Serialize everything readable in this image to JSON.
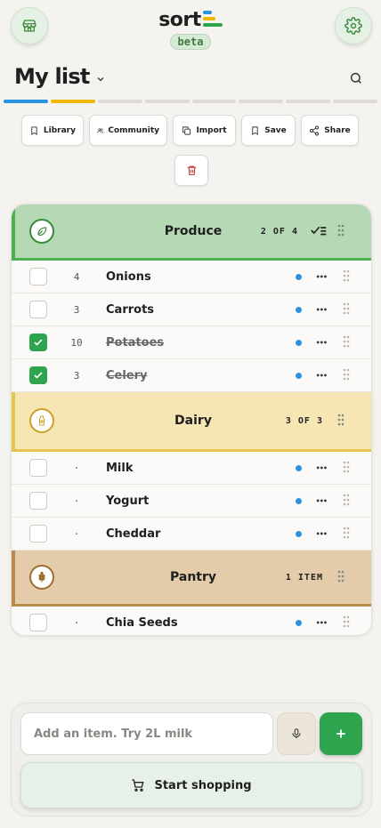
{
  "header": {
    "logo_text": "sort",
    "logo_bar_colors": [
      "#2a93e0",
      "#f2b705",
      "#2ea44f"
    ],
    "badge": "beta",
    "list_title": "My list"
  },
  "progress_segment_colors": [
    "#2a93e0",
    "#f2b705",
    "#dedbd5",
    "#dedbd5",
    "#dedbd5",
    "#dedbd5",
    "#dedbd5",
    "#dedbd5"
  ],
  "toolbar": {
    "library": "Library",
    "community": "Community",
    "import": "Import",
    "save": "Save",
    "share": "Share"
  },
  "categories": [
    {
      "name": "Produce",
      "count": "2 OF 4",
      "icon": "leaf-icon",
      "colors": {
        "bg": "#b4d9b4",
        "accent": "#4caf50",
        "icon": "#3b8a3b"
      },
      "items": [
        {
          "qty": "4",
          "name": "Onions",
          "checked": false
        },
        {
          "qty": "3",
          "name": "Carrots",
          "checked": false
        },
        {
          "qty": "10",
          "name": "Potatoes",
          "checked": true
        },
        {
          "qty": "3",
          "name": "Celery",
          "checked": true
        }
      ]
    },
    {
      "name": "Dairy",
      "count": "3 OF 3",
      "icon": "milk-bottle-icon",
      "colors": {
        "bg": "#f6e6b4",
        "accent": "#e7c54b",
        "icon": "#c9a227"
      },
      "items": [
        {
          "qty": "·",
          "name": "Milk",
          "checked": false
        },
        {
          "qty": "·",
          "name": "Yogurt",
          "checked": false
        },
        {
          "qty": "·",
          "name": "Cheddar",
          "checked": false
        }
      ]
    },
    {
      "name": "Pantry",
      "count": "1 ITEM",
      "icon": "wheat-icon",
      "colors": {
        "bg": "#e4ccaa",
        "accent": "#b88a48",
        "icon": "#9c6f2e"
      },
      "items": [
        {
          "qty": "·",
          "name": "Chia Seeds",
          "checked": false
        }
      ]
    }
  ],
  "composer": {
    "placeholder": "Add an item. Try 2L milk",
    "start_label": "Start shopping"
  },
  "colors": {
    "accent_green": "#2ea44f",
    "tag_blue": "#2a93e0"
  }
}
